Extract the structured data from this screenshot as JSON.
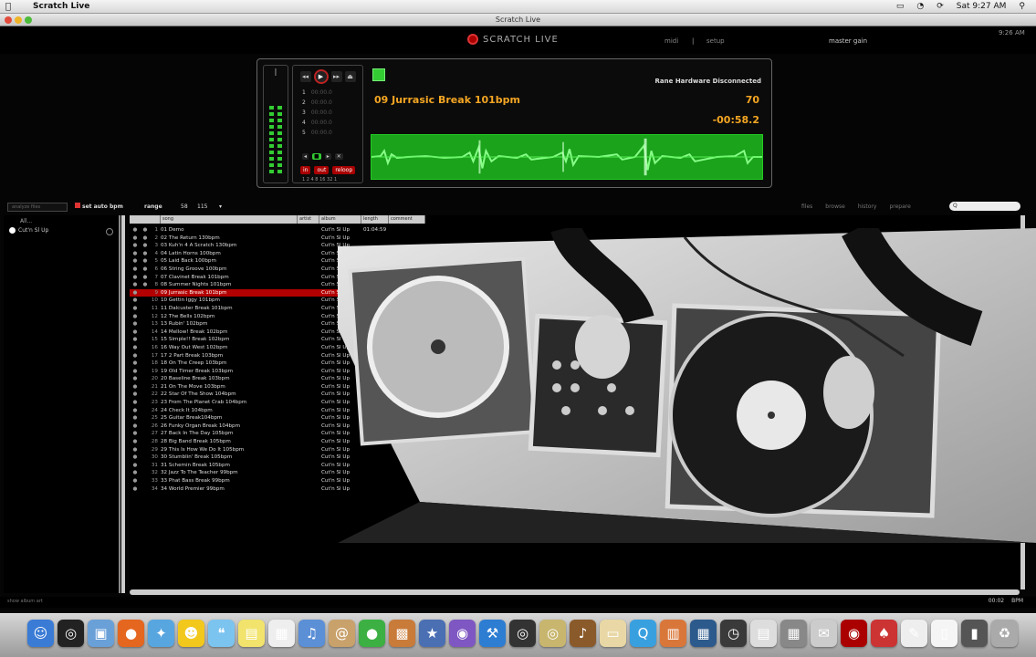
{
  "menubar": {
    "app_name": "Scratch Live",
    "time": "Sat 9:27 AM"
  },
  "window": {
    "title": "Scratch Live"
  },
  "header": {
    "logo": "SCRATCH LIVE",
    "link_midi": "midi",
    "link_setup": "setup",
    "master_gain": "master gain",
    "clock": "9:26 AM"
  },
  "deck": {
    "hardware_status": "Rane Hardware Disconnected",
    "track_title": "09 Jurrasic Break 101bpm",
    "bpm": "70",
    "time_remaining": "-00:58.2",
    "cue_points": [
      "1",
      "2",
      "3",
      "4",
      "5"
    ],
    "loop_buttons": [
      "in",
      "out",
      "reloop"
    ],
    "loop_sizes": "1 2 4 8 16 32 1"
  },
  "browser_toolbar": {
    "search_placeholder": "analyze files",
    "autoload_label": "set auto bpm",
    "range_label": "range",
    "range_min": "58",
    "range_max": "115",
    "tabs": [
      "files",
      "browse",
      "history",
      "prepare"
    ],
    "search_field_value": "Q"
  },
  "crates": {
    "all_label": "All...",
    "items": [
      "Cut'n Sl Up"
    ]
  },
  "columns": [
    "song",
    "artist",
    "album",
    "length",
    "comment"
  ],
  "tracks": [
    {
      "n": "1",
      "song": "01 Demo",
      "artist": "Cut'n Sl Up",
      "length": "01:04:59"
    },
    {
      "n": "2",
      "song": "02 The Return 130bpm",
      "artist": "Cut'n Sl Up",
      "length": ""
    },
    {
      "n": "3",
      "song": "03 Kuh'n 4 A Scratch 130bpm",
      "artist": "Cut'n Sl Up",
      "length": ""
    },
    {
      "n": "4",
      "song": "04 Latin Horns 100bpm",
      "artist": "Cut'n Sl Up",
      "length": ""
    },
    {
      "n": "5",
      "song": "05 Laid Back 100bpm",
      "artist": "Cut'n Sl Up",
      "length": ""
    },
    {
      "n": "6",
      "song": "06 String Groove 100bpm",
      "artist": "Cut'n Sl Up",
      "length": ""
    },
    {
      "n": "7",
      "song": "07 Clavinet Break 101bpm",
      "artist": "Cut'n Sl Up",
      "length": ""
    },
    {
      "n": "8",
      "song": "08 Summer Nights 101bpm",
      "artist": "Cut'n Sl Up",
      "length": ""
    },
    {
      "n": "9",
      "song": "09 Jurrasic Break 101bpm",
      "artist": "Cut'n Sl Up",
      "length": ""
    },
    {
      "n": "10",
      "song": "10 Gettin Iggy 101bpm",
      "artist": "Cut'n Sl Up",
      "length": ""
    },
    {
      "n": "11",
      "song": "11 Dalcuster Break 101bpm",
      "artist": "Cut'n Sl Up",
      "length": ""
    },
    {
      "n": "12",
      "song": "12 The Bells 102bpm",
      "artist": "Cut'n Sl Up",
      "length": ""
    },
    {
      "n": "13",
      "song": "13 Rubin' 102bpm",
      "artist": "Cut'n Sl Up",
      "length": ""
    },
    {
      "n": "14",
      "song": "14 Mellow! Break 102bpm",
      "artist": "Cut'n Sl Up",
      "length": ""
    },
    {
      "n": "15",
      "song": "15 Simple!! Break 102bpm",
      "artist": "Cut'n Sl Up",
      "length": ""
    },
    {
      "n": "16",
      "song": "16 Way Out West 102bpm",
      "artist": "Cut'n Sl Up",
      "length": ""
    },
    {
      "n": "17",
      "song": "17 2 Part Break 103bpm",
      "artist": "Cut'n Sl Up",
      "length": ""
    },
    {
      "n": "18",
      "song": "18 On The Creep 103bpm",
      "artist": "Cut'n Sl Up",
      "length": ""
    },
    {
      "n": "19",
      "song": "19 Old Timer Break 103bpm",
      "artist": "Cut'n Sl Up",
      "length": ""
    },
    {
      "n": "20",
      "song": "20 Baseline Break 103bpm",
      "artist": "Cut'n Sl Up",
      "length": ""
    },
    {
      "n": "21",
      "song": "21 On The Move 103bpm",
      "artist": "Cut'n Sl Up",
      "length": ""
    },
    {
      "n": "22",
      "song": "22 Star Of The Show 104bpm",
      "artist": "Cut'n Sl Up",
      "length": ""
    },
    {
      "n": "23",
      "song": "23 From The Planet Crab 104bpm",
      "artist": "Cut'n Sl Up",
      "length": ""
    },
    {
      "n": "24",
      "song": "24 Check It 104bpm",
      "artist": "Cut'n Sl Up",
      "length": ""
    },
    {
      "n": "25",
      "song": "25 Guitar Break104bpm",
      "artist": "Cut'n Sl Up",
      "length": ""
    },
    {
      "n": "26",
      "song": "26 Funky Organ Break 104bpm",
      "artist": "Cut'n Sl Up",
      "length": ""
    },
    {
      "n": "27",
      "song": "27 Back In The Day 105bpm",
      "artist": "Cut'n Sl Up",
      "length": ""
    },
    {
      "n": "28",
      "song": "28 Big Band Break 105bpm",
      "artist": "Cut'n Sl Up",
      "length": ""
    },
    {
      "n": "29",
      "song": "29 This Is How We Do It 105bpm",
      "artist": "Cut'n Sl Up",
      "length": ""
    },
    {
      "n": "30",
      "song": "30 Stumblin' Break 105bpm",
      "artist": "Cut'n Sl Up",
      "length": ""
    },
    {
      "n": "31",
      "song": "31 Schemin Break 105bpm",
      "artist": "Cut'n Sl Up",
      "length": ""
    },
    {
      "n": "32",
      "song": "32 Jazz To The Teacher 99bpm",
      "artist": "Cut'n Sl Up",
      "length": ""
    },
    {
      "n": "33",
      "song": "33 Phat Bass Break 99bpm",
      "artist": "Cut'n Sl Up",
      "length": ""
    },
    {
      "n": "34",
      "song": "34 World Premier 99bpm",
      "artist": "Cut'n Sl Up",
      "length": ""
    }
  ],
  "status": {
    "left": "show album art",
    "right_count": "00:02",
    "right_btn": "BPM"
  },
  "dock": {
    "icons": [
      {
        "name": "finder-icon",
        "color": "#3a7bd5",
        "glyph": "☺"
      },
      {
        "name": "dashboard-icon",
        "color": "#222",
        "glyph": "◎"
      },
      {
        "name": "preview-icon",
        "color": "#6aa0d8",
        "glyph": "▣"
      },
      {
        "name": "firefox-icon",
        "color": "#e5661f",
        "glyph": "●"
      },
      {
        "name": "safari-icon",
        "color": "#58a6e0",
        "glyph": "✦"
      },
      {
        "name": "messenger-icon",
        "color": "#f2c81d",
        "glyph": "☻"
      },
      {
        "name": "ichat-icon",
        "color": "#7cc4f0",
        "glyph": "❝"
      },
      {
        "name": "stickies-icon",
        "color": "#f2e36c",
        "glyph": "▤"
      },
      {
        "name": "ical-icon",
        "color": "#eee",
        "glyph": "▦"
      },
      {
        "name": "itunes-icon",
        "color": "#5b8fd6",
        "glyph": "♫"
      },
      {
        "name": "addressbook-icon",
        "color": "#c9a16b",
        "glyph": "@"
      },
      {
        "name": "facetime-icon",
        "color": "#3cb043",
        "glyph": "●"
      },
      {
        "name": "photos-icon",
        "color": "#c97b3a",
        "glyph": "▩"
      },
      {
        "name": "imovie-icon",
        "color": "#4a6fb3",
        "glyph": "★"
      },
      {
        "name": "photobooth-icon",
        "color": "#7e57c2",
        "glyph": "◉"
      },
      {
        "name": "xcode-icon",
        "color": "#2d7dd2",
        "glyph": "⚒"
      },
      {
        "name": "dvd-icon",
        "color": "#333",
        "glyph": "◎"
      },
      {
        "name": "cd-icon",
        "color": "#c8b66f",
        "glyph": "◎"
      },
      {
        "name": "guitar-icon",
        "color": "#8b5a2b",
        "glyph": "♪"
      },
      {
        "name": "folder-icon",
        "color": "#e9d8a6",
        "glyph": "▭"
      },
      {
        "name": "quicktime-icon",
        "color": "#39a0e0",
        "glyph": "Q"
      },
      {
        "name": "cards-icon",
        "color": "#d9773a",
        "glyph": "▥"
      },
      {
        "name": "expose-icon",
        "color": "#2c5a8c",
        "glyph": "▦"
      },
      {
        "name": "timemachine-icon",
        "color": "#3a3a3a",
        "glyph": "◷"
      },
      {
        "name": "document-icon",
        "color": "#ddd",
        "glyph": "▤"
      },
      {
        "name": "grid-icon",
        "color": "#888",
        "glyph": "▦"
      },
      {
        "name": "mail-icon",
        "color": "#ccc",
        "glyph": "✉"
      },
      {
        "name": "scratchlive-icon",
        "color": "#a00",
        "glyph": "◉"
      },
      {
        "name": "serato-icon",
        "color": "#c33",
        "glyph": "♠"
      },
      {
        "name": "textedit-icon",
        "color": "#eee",
        "glyph": "✎"
      },
      {
        "name": "page-icon",
        "color": "#f5f5f5",
        "glyph": "▯"
      },
      {
        "name": "script-icon",
        "color": "#555",
        "glyph": "▮"
      },
      {
        "name": "trash-icon",
        "color": "#aaa",
        "glyph": "♻"
      }
    ]
  }
}
